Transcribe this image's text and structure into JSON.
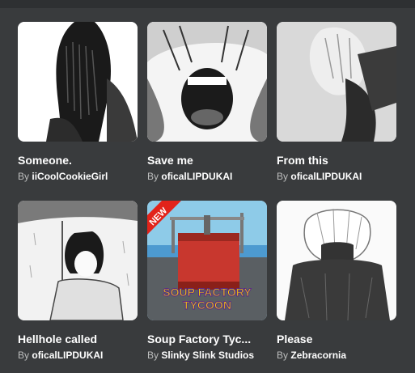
{
  "games": [
    {
      "title": "Someone.",
      "by": "By",
      "creator": "iiCoolCookieGirl",
      "icon": "sad-girl-hair-over-face"
    },
    {
      "title": "Save me",
      "by": "By",
      "creator": "oficalLIPDUKAI",
      "icon": "screaming-boy"
    },
    {
      "title": "From this",
      "by": "By",
      "creator": "oficalLIPDUKAI",
      "icon": "crying-boy-looking-down"
    },
    {
      "title": "Hellhole called",
      "by": "By",
      "creator": "oficalLIPDUKAI",
      "icon": "boy-under-umbrella-rain"
    },
    {
      "title": "Soup Factory Tyc...",
      "by": "By",
      "creator": "Slinky Slink Studios",
      "icon": "soup-factory-tank",
      "badge": "NEW",
      "logo_line1": "SOUP FACTORY",
      "logo_line2": "TYCOON"
    },
    {
      "title": "Please",
      "by": "By",
      "creator": "Zebracornia",
      "icon": "white-haired-boy-hands-on-face"
    }
  ],
  "colors": {
    "background": "#393b3d",
    "title": "#ffffff",
    "byline": "#bdbebe",
    "new_badge": "#e2231a"
  }
}
